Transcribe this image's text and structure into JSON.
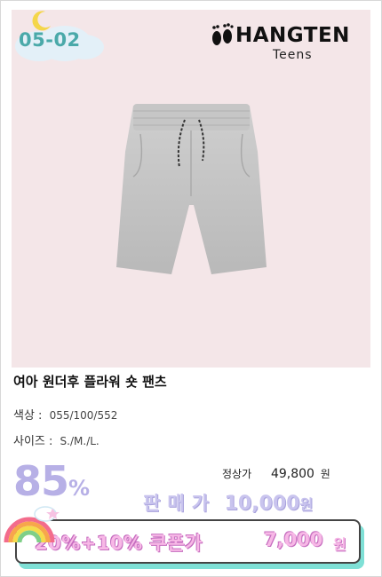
{
  "badge": {
    "date": "05-02"
  },
  "brand": {
    "name": "HANGTEN",
    "sub": "Teens"
  },
  "product": {
    "title": "여아 원더후 플라워 숏 팬츠",
    "image_alt": "grey drawstring shorts",
    "color_label": "색상 :",
    "color_value": "055/100/552",
    "size_label": "사이즈 :",
    "size_value": "S./M./L."
  },
  "pricing": {
    "discount_num": "85",
    "discount_pct": "%",
    "regular_label": "정상가",
    "regular_price": "49,800",
    "regular_unit": "원",
    "sale_label": "판매가",
    "sale_price": "10,000",
    "sale_unit": "원",
    "coupon_label": "20%+10% 쿠폰가",
    "coupon_price": "7,000",
    "coupon_unit": "원"
  },
  "colors": {
    "image_bg": "#f4e6e8",
    "discount": "#b7b0e6",
    "coupon_text": "#f7b8e6",
    "coupon_shadow": "#7fe0d6",
    "date": "#4aa9a9"
  }
}
